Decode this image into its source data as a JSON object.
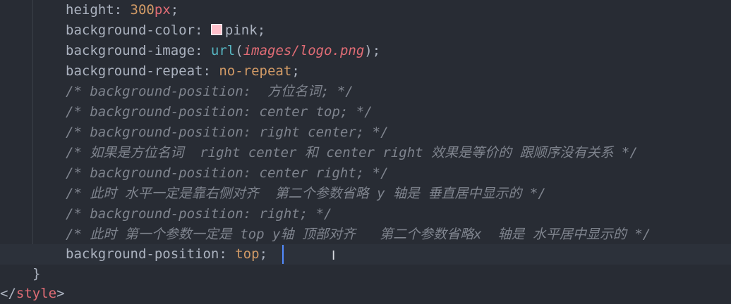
{
  "editor": {
    "lines": [
      {
        "prop": "height",
        "sep": ": ",
        "num": "300",
        "unit": "px",
        "end": ";"
      },
      {
        "prop": "background-color",
        "sep": ": ",
        "value": "pink",
        "end": ";",
        "swatch_color": "#ffc0cb"
      },
      {
        "prop": "background-image",
        "sep": ": ",
        "fn": "url",
        "open": "(",
        "arg": "images/logo.png",
        "close": ")",
        "end": ";"
      },
      {
        "prop": "background-repeat",
        "sep": ": ",
        "value": "no-repeat",
        "end": ";"
      },
      {
        "comment": "/* background-position:  方位名词; */"
      },
      {
        "comment": "/* background-position: center top; */"
      },
      {
        "comment": "/* background-position: right center; */"
      },
      {
        "comment": "/* 如果是方位名词  right center 和 center right 效果是等价的 跟顺序没有关系 */"
      },
      {
        "comment": "/* background-position: center right; */"
      },
      {
        "comment": "/* 此时 水平一定是靠右侧对齐  第二个参数省略 y 轴是 垂直居中显示的 */"
      },
      {
        "comment": "/* background-position: right; */"
      },
      {
        "comment": "/* 此时 第一个参数一定是 top y轴 顶部对齐   第二个参数省略x  轴是 水平居中显示的 */"
      },
      {
        "prop": "background-position",
        "sep": ": ",
        "value": "top",
        "end": "; "
      }
    ],
    "closing_brace": "}",
    "closing_tag": {
      "open": "</",
      "name": "style",
      "close": ">"
    },
    "cursor_glyph": "I"
  },
  "colors": {
    "background": "#282c34",
    "current_line": "#2c313a",
    "property": "#abb2bf",
    "number": "#d19a66",
    "unit": "#e06c75",
    "string": "#e06c75",
    "function": "#56b6c2",
    "comment": "#7f848e",
    "caret": "#528bff"
  }
}
